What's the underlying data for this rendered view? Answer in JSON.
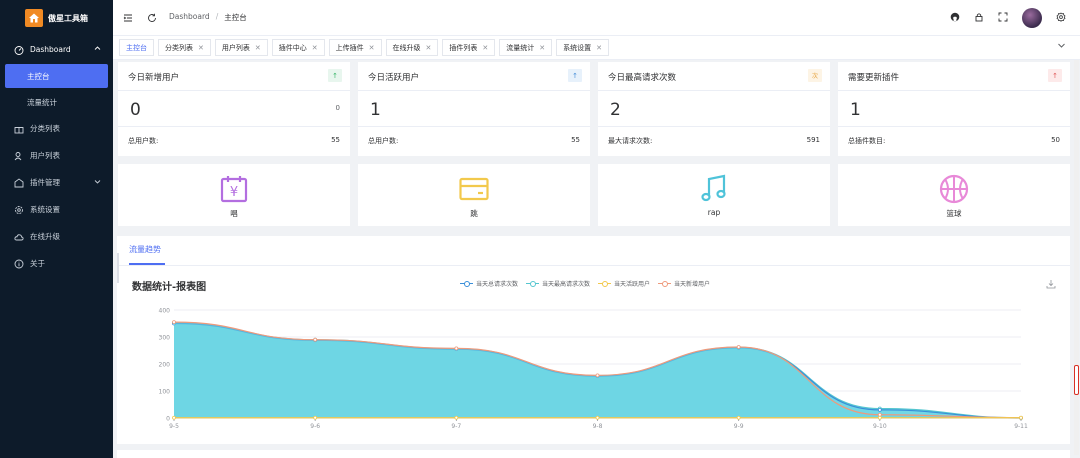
{
  "app": {
    "name": "傲星工具箱"
  },
  "colors": {
    "sidebar_bg": "#0d1b2a",
    "accent": "#4e6ef2",
    "area": "#6cd6e4",
    "line": "#ee9a7c"
  },
  "sidebar": {
    "dashboard": {
      "label": "Dashboard",
      "icon": "dashboard-icon"
    },
    "sub": [
      {
        "label": "主控台",
        "active": true
      },
      {
        "label": "流量统计",
        "active": false
      }
    ],
    "items": [
      {
        "label": "分类列表",
        "icon": "gift-icon"
      },
      {
        "label": "用户列表",
        "icon": "users-icon"
      },
      {
        "label": "插件管理",
        "icon": "plugin-icon",
        "has_arrow": true
      },
      {
        "label": "系统设置",
        "icon": "gear-icon"
      },
      {
        "label": "在线升级",
        "icon": "cloud-icon"
      },
      {
        "label": "关于",
        "icon": "info-icon"
      }
    ]
  },
  "header": {
    "breadcrumb": {
      "root": "Dashboard",
      "sep": "/",
      "current": "主控台"
    }
  },
  "tabs": [
    {
      "label": "主控台",
      "active": true,
      "closable": false
    },
    {
      "label": "分类列表",
      "closable": true
    },
    {
      "label": "用户列表",
      "closable": true
    },
    {
      "label": "插件中心",
      "closable": true
    },
    {
      "label": "上传插件",
      "closable": true
    },
    {
      "label": "在线升级",
      "closable": true
    },
    {
      "label": "插件列表",
      "closable": true
    },
    {
      "label": "流量统计",
      "closable": true
    },
    {
      "label": "系统设置",
      "closable": true
    }
  ],
  "stats": [
    {
      "title": "今日新增用户",
      "value": "0",
      "small": "0",
      "foot_label": "总用户数:",
      "foot_value": "55",
      "badge_color": "#3bb66a",
      "badge_bg": "#e8f6ee"
    },
    {
      "title": "今日活跃用户",
      "value": "1",
      "small": "",
      "foot_label": "总用户数:",
      "foot_value": "55",
      "badge_color": "#4a90d9",
      "badge_bg": "#e7f1fb"
    },
    {
      "title": "今日最高请求次数",
      "value": "2",
      "small": "",
      "foot_label": "最大请求次数:",
      "foot_value": "591",
      "badge_color": "#e6a23c",
      "badge_bg": "#fdf4e5",
      "badge_text": "次"
    },
    {
      "title": "需要更新插件",
      "value": "1",
      "small": "",
      "foot_label": "总插件数目:",
      "foot_value": "50",
      "badge_color": "#e05a5a",
      "badge_bg": "#fdeaea"
    }
  ],
  "icon_cards": [
    {
      "label": "唱",
      "icon": "calendar-yen-icon",
      "color": "#b36ee0"
    },
    {
      "label": "跳",
      "icon": "credit-card-icon",
      "color": "#f2c94c"
    },
    {
      "label": "rap",
      "icon": "music-note-icon",
      "color": "#4fc3d9"
    },
    {
      "label": "篮球",
      "icon": "basketball-icon",
      "color": "#e889d8"
    }
  ],
  "panel": {
    "tab": "流量趋势",
    "title": "数据统计-报表图"
  },
  "chart_data": {
    "type": "area",
    "x": [
      "9-5",
      "9-6",
      "9-7",
      "9-8",
      "9-9",
      "9-10",
      "9-11"
    ],
    "ylim": [
      0,
      400
    ],
    "yticks": [
      0,
      100,
      200,
      300,
      400
    ],
    "grid": true,
    "legend_position": "top-center",
    "series": [
      {
        "name": "当天总请求次数",
        "color": "#3a8fd9",
        "values": [
          350,
          288,
          255,
          155,
          260,
          30,
          0
        ]
      },
      {
        "name": "当天最高请求次数",
        "color": "#55c6cf",
        "values": [
          352,
          290,
          257,
          157,
          262,
          35,
          1
        ]
      },
      {
        "name": "当天活跃用户",
        "color": "#f2c94c",
        "values": [
          1,
          1,
          1,
          1,
          1,
          1,
          1
        ]
      },
      {
        "name": "当天新增用户",
        "color": "#ee9a7c",
        "values": [
          355,
          290,
          258,
          158,
          263,
          12,
          1
        ]
      }
    ]
  }
}
